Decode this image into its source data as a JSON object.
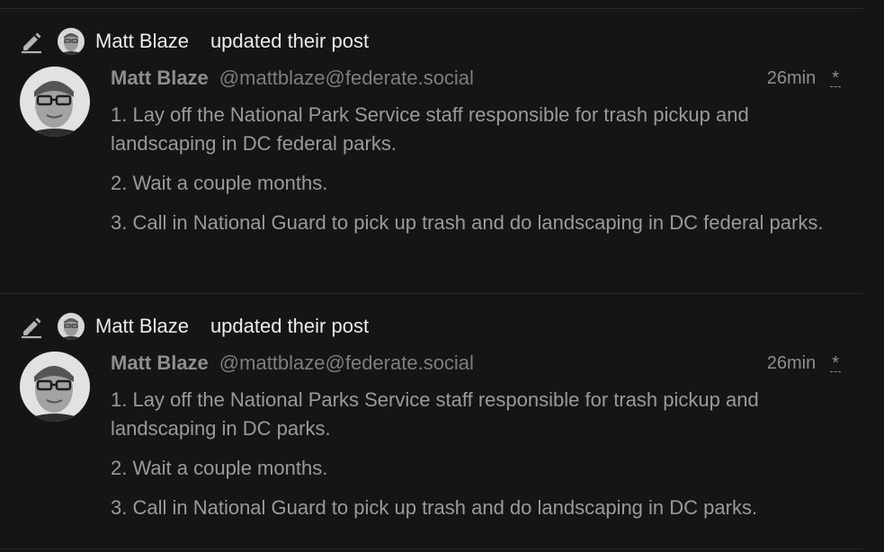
{
  "notifications": [
    {
      "header": {
        "name": "Matt Blaze",
        "action": "updated their post"
      },
      "post": {
        "author": "Matt Blaze",
        "handle_user": "@mattblaze",
        "handle_domain": "@federate.social",
        "time": "26min",
        "edited_mark": "*",
        "paragraphs": [
          "1. Lay off the National Park Service staff responsible for trash pickup and landscaping in DC federal parks.",
          "2. Wait a couple months.",
          "3. Call in National Guard to pick up trash and do landscaping in DC federal parks."
        ]
      }
    },
    {
      "header": {
        "name": "Matt Blaze",
        "action": "updated their post"
      },
      "post": {
        "author": "Matt Blaze",
        "handle_user": "@mattblaze",
        "handle_domain": "@federate.social",
        "time": "26min",
        "edited_mark": "*",
        "paragraphs": [
          "1. Lay off the National Parks Service staff responsible for trash pickup and landscaping in DC parks.",
          "2. Wait a couple months.",
          "3. Call in National Guard to pick up trash and do landscaping in DC parks."
        ]
      }
    }
  ],
  "colors": {
    "background": "#151515",
    "header_text": "#ececec",
    "muted_text": "#9a9a9a",
    "icon": "#b5b5b5"
  },
  "icons": {
    "edit": "pencil-icon"
  }
}
